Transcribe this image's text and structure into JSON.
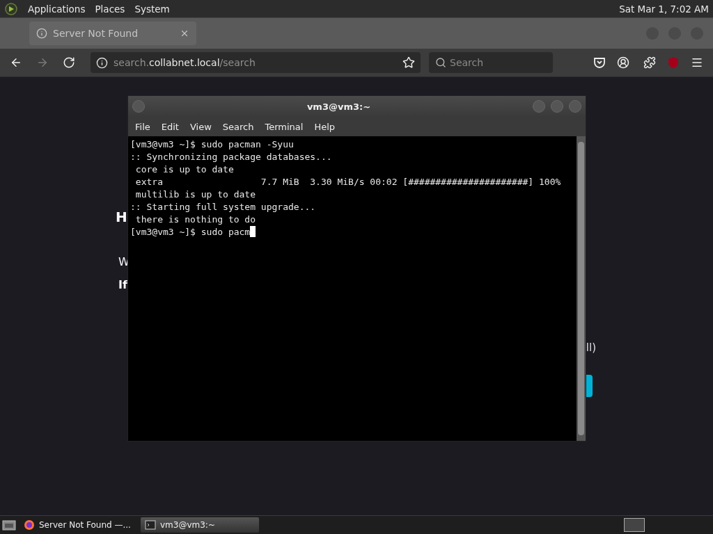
{
  "top_panel": {
    "menus": [
      "Applications",
      "Places",
      "System"
    ],
    "clock": "Sat Mar 1, 7:02 AM"
  },
  "browser": {
    "tabs": [
      {
        "title": "Server Not Found",
        "selected": true
      }
    ],
    "nav": {
      "forward_disabled": true,
      "url": {
        "prefix": "search.",
        "domain": "collabnet.local",
        "path": "/search"
      },
      "search": {
        "placeholder": "Search"
      }
    },
    "page": {
      "heading": "H",
      "line_1": "W",
      "line_2": "If",
      "right_text": "ll)"
    }
  },
  "terminal": {
    "title": "vm3@vm3:~",
    "menus": [
      "File",
      "Edit",
      "View",
      "Search",
      "Terminal",
      "Help"
    ],
    "lines": [
      "[vm3@vm3 ~]$ sudo pacman -Syuu",
      ":: Synchronizing package databases...",
      " core is up to date",
      " extra                  7.7 MiB  3.30 MiB/s 00:02 [######################] 100%",
      " multilib is up to date",
      ":: Starting full system upgrade...",
      " there is nothing to do"
    ],
    "prompt": "[vm3@vm3 ~]$ sudo pacm"
  },
  "taskbar": {
    "tasks": [
      {
        "kind": "browser",
        "label": "Server Not Found —...",
        "selected": false
      },
      {
        "kind": "terminal",
        "label": "vm3@vm3:~",
        "selected": true
      }
    ]
  }
}
